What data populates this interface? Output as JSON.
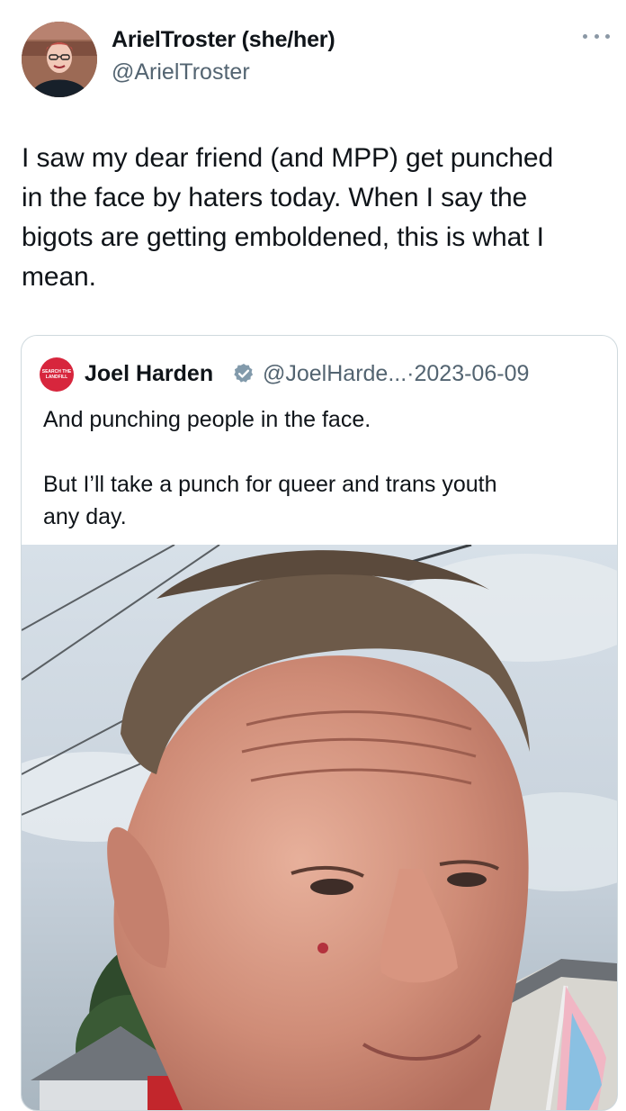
{
  "author": {
    "display_name": "ArielTroster (she/her)",
    "handle": "@ArielTroster"
  },
  "tweet": {
    "text": "I saw my dear friend (and MPP) get punched\nin the face by haters today. When I say the\nbigots are getting emboldened, this is what I\nmean."
  },
  "quoted_tweet": {
    "display_name": "Joel Harden",
    "handle_date": "@JoelHarde...·2023-06-09",
    "text": "And punching people in the face.\n\nBut I’ll take a punch for queer and trans youth\nany day.",
    "avatar_text": "SEARCH THE LANDFILL"
  },
  "icons": {
    "more": "more-horizontal-icon",
    "verified": "verified-badge-icon"
  },
  "colors": {
    "secondary_text": "#536471",
    "verified_fill": "#829aab",
    "border": "#cfd9de"
  }
}
